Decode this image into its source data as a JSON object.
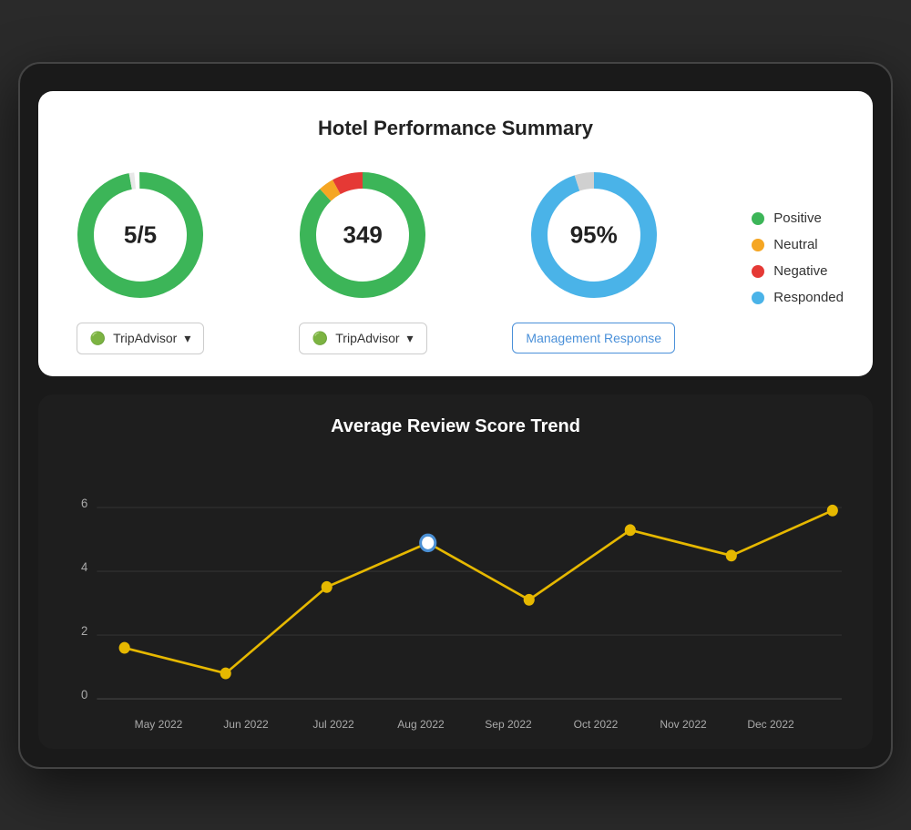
{
  "title": "Hotel Performance Summary",
  "chart1": {
    "value": "5/5",
    "type": "rating",
    "segments": [
      {
        "color": "#3cb558",
        "percent": 97
      },
      {
        "color": "#e8e8e8",
        "percent": 3
      }
    ],
    "dropdown": "TripAdvisor"
  },
  "chart2": {
    "value": "349",
    "type": "reviews",
    "segments": [
      {
        "color": "#3cb558",
        "percent": 88
      },
      {
        "color": "#f5a623",
        "percent": 4
      },
      {
        "color": "#e53935",
        "percent": 8
      }
    ],
    "dropdown": "TripAdvisor"
  },
  "chart3": {
    "value": "95%",
    "type": "response",
    "segments": [
      {
        "color": "#4ab3e8",
        "percent": 95
      },
      {
        "color": "#d0d0d0",
        "percent": 5
      }
    ],
    "button": "Management Response"
  },
  "legend": [
    {
      "label": "Positive",
      "color": "#3cb558"
    },
    {
      "label": "Neutral",
      "color": "#f5a623"
    },
    {
      "label": "Negative",
      "color": "#e53935"
    },
    {
      "label": "Responded",
      "color": "#4ab3e8"
    }
  ],
  "trendChart": {
    "title": "Average Review Score Trend",
    "yLabels": [
      "0",
      "2",
      "4",
      "6"
    ],
    "xLabels": [
      "May 2022",
      "Jun 2022",
      "Jul 2022",
      "Aug 2022",
      "Sep 2022",
      "Oct 2022",
      "Nov 2022",
      "Dec 2022"
    ],
    "dataPoints": [
      {
        "x": "May 2022",
        "y": 1.6
      },
      {
        "x": "Jun 2022",
        "y": 0.8
      },
      {
        "x": "Jul 2022",
        "y": 3.5
      },
      {
        "x": "Aug 2022",
        "y": 4.9
      },
      {
        "x": "Sep 2022",
        "y": 3.1
      },
      {
        "x": "Oct 2022",
        "y": 5.3
      },
      {
        "x": "Nov 2022",
        "y": 4.5
      },
      {
        "x": "Dec 2022",
        "y": 5.9
      }
    ],
    "highlightIndex": 3,
    "lineColor": "#e6b800",
    "dotColor": "#e6b800"
  }
}
